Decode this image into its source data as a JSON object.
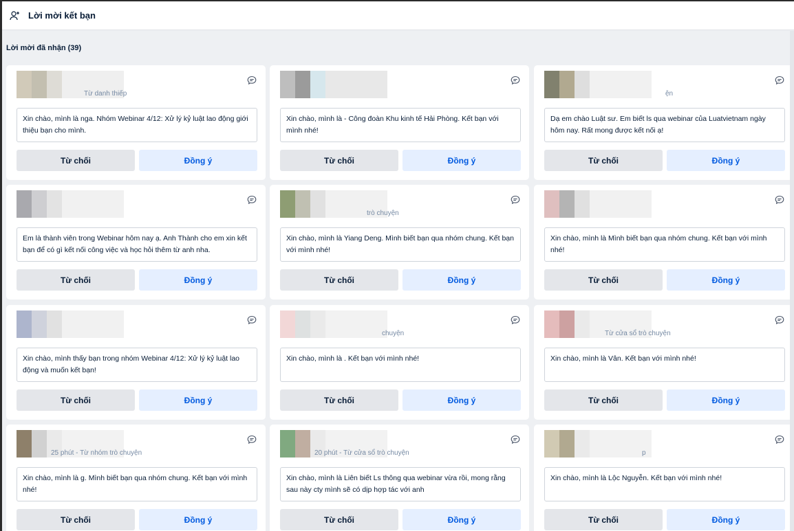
{
  "header": {
    "title": "Lời mời kết bạn",
    "icon": "add-user-icon"
  },
  "section": {
    "title": "Lời mời đã nhận (39)"
  },
  "labels": {
    "reject": "Từ chối",
    "accept": "Đồng ý"
  },
  "cards": [
    {
      "source": "Từ danh thiếp",
      "message": "Xin chào, mình là nga. Nhóm Webinar 4/12: Xử lý kỷ luật lao động giới thiệu bạn cho mình."
    },
    {
      "source": "",
      "message": "Xin chào, mình là                                  - Công đoàn Khu kinh tế Hải Phòng. Kết bạn với mình nhé!"
    },
    {
      "source": "ện",
      "message": "Dạ em chào Luật sư. Em biết ls qua webinar của Luatvietnam ngày hôm nay. Rất mong được kết nối ạ!"
    },
    {
      "source": "",
      "message": "Em là thành viên trong Webinar hôm nay ạ. Anh Thành cho em xin kết bạn để có gì kết nối công việc và học hỏi thêm từ anh nha."
    },
    {
      "source": "trò chuyện",
      "message": "Xin chào, mình là Yiang Deng. Mình biết bạn qua nhóm chung. Kết bạn với mình nhé!"
    },
    {
      "source": "",
      "message": "Xin chào, mình là                             Mình biết bạn qua nhóm chung. Kết bạn với mình nhé!"
    },
    {
      "source": "",
      "message": "Xin chào, mình thấy bạn trong nhóm Webinar 4/12: Xử lý kỷ luật lao động và muốn kết bạn!"
    },
    {
      "source": "chuyện",
      "message": "Xin chào, mình là                . Kết bạn với mình nhé!"
    },
    {
      "source": "Từ cửa sổ trò chuyện",
      "message": "Xin chào, mình là Vân. Kết bạn với mình nhé!"
    },
    {
      "source": "25 phút - Từ nhóm trò chuyện",
      "message": "Xin chào, mình là                   g. Mình biết bạn qua nhóm chung. Kết bạn với mình nhé!"
    },
    {
      "source": "20 phút - Từ cửa sổ trò chuyện",
      "message": "Xin chào, mình là Liên biết Ls thông qua webinar vừa rồi, mong rằng sau này cty mình sẽ có dịp hợp tác với anh"
    },
    {
      "source": "p",
      "message": "Xin chào, mình là Lộc Nguyễn. Kết bạn với mình nhé!"
    }
  ],
  "colors": {
    "accent": "#005ae0",
    "accept_bg": "#e5efff",
    "reject_bg": "#e4e6ea",
    "page_bg": "#eef0f3"
  }
}
